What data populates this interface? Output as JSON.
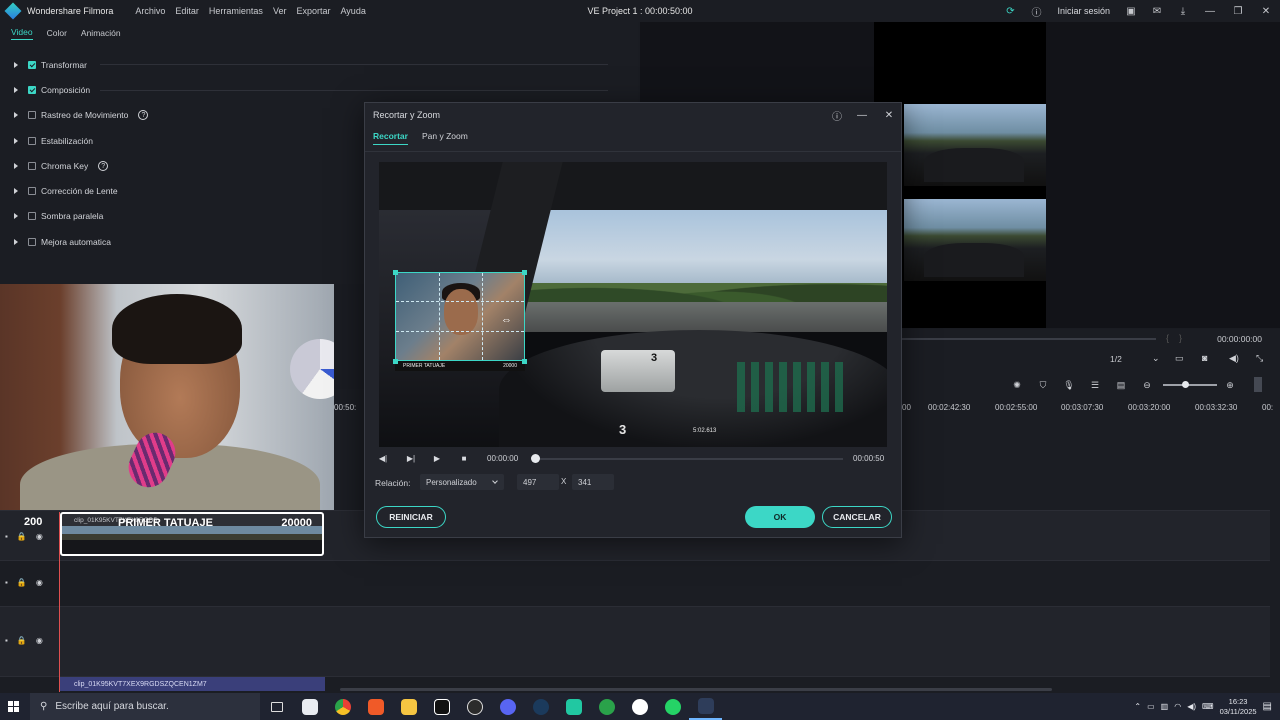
{
  "app": {
    "name": "Wondershare Filmora",
    "project_title": "VE Project 1 : 00:00:50:00",
    "menu": [
      "Archivo",
      "Editar",
      "Herramientas",
      "Ver",
      "Exportar",
      "Ayuda"
    ],
    "signin": "Iniciar sesión"
  },
  "properties": {
    "tabs": [
      "Video",
      "Color",
      "Animación"
    ],
    "active_tab": "Video",
    "rows": [
      {
        "label": "Transformar",
        "checked": true,
        "help": false
      },
      {
        "label": "Composición",
        "checked": true,
        "help": false
      },
      {
        "label": "Rastreo de Movimiento",
        "checked": false,
        "help": true
      },
      {
        "label": "Estabilización",
        "checked": false,
        "help": false
      },
      {
        "label": "Chroma Key",
        "checked": false,
        "help": true
      },
      {
        "label": "Corrección de Lente",
        "checked": false,
        "help": false
      },
      {
        "label": "Sombra paralela",
        "checked": false,
        "help": false
      },
      {
        "label": "Mejora automatica",
        "checked": false,
        "help": false
      }
    ]
  },
  "preview": {
    "time": "00:00:00:00",
    "page": "1/2"
  },
  "timeline": {
    "ruler": [
      "00:50:",
      "00",
      "00:02:42:30",
      "00:02:55:00",
      "00:03:07:30",
      "00:03:20:00",
      "00:03:32:30",
      "00:"
    ],
    "clip_name": "clip_01K95KVT7XEX9RGD5",
    "clip_title": "PRIMER TATUAJE",
    "clip_count": "20000",
    "counter": "200",
    "audio_clip": "clip_01K95KVT7XEX9RGDSZQCEN1ZM7"
  },
  "dialog": {
    "title": "Recortar y Zoom",
    "tabs": [
      "Recortar",
      "Pan y Zoom"
    ],
    "active_tab": "Recortar",
    "time_current": "00:00:00",
    "time_total": "00:00:50",
    "ratio_label": "Relación:",
    "ratio_value": "Personalizado",
    "width": "497",
    "x_sep": "X",
    "height": "341",
    "reset_label": "REINICIAR",
    "ok_label": "OK",
    "cancel_label": "CANCELAR",
    "crop_caption_left": "PRIMER TATUAJE",
    "crop_caption_right": "20000",
    "hud_gear": "3",
    "hud_time": "5:02.613",
    "dash_speed": "3"
  },
  "taskbar": {
    "search_placeholder": "Escribe aquí para buscar.",
    "time": "16:23",
    "date": "03/11/2025"
  },
  "colors": {
    "accent": "#3cd7c6",
    "panel": "#1b1d23",
    "dialog": "#22242b"
  }
}
